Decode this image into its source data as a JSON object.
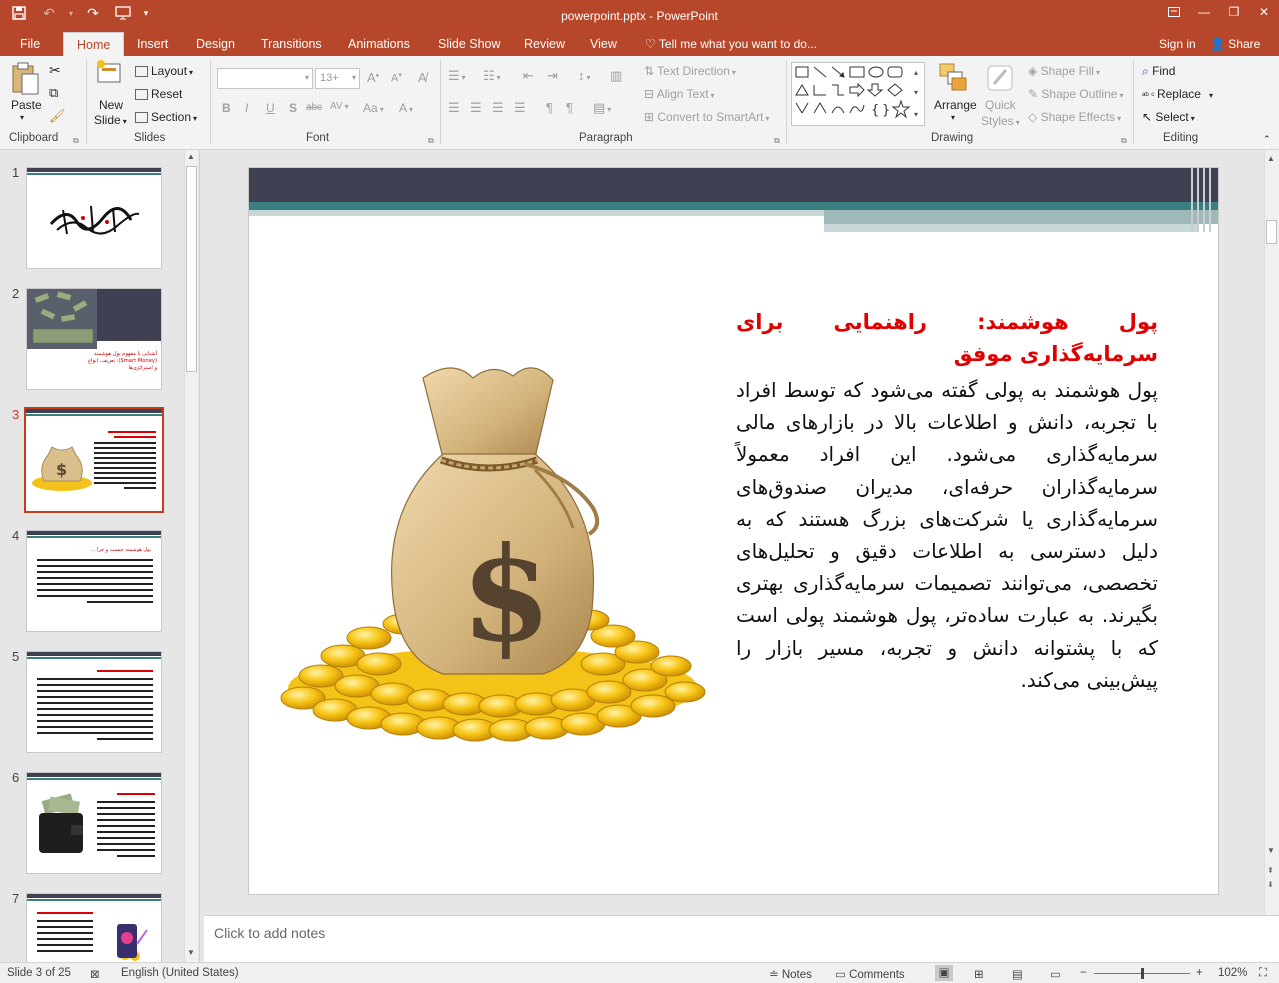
{
  "window": {
    "title": "powerpoint.pptx - PowerPoint"
  },
  "tabs": [
    {
      "label": "File"
    },
    {
      "label": "Home"
    },
    {
      "label": "Insert"
    },
    {
      "label": "Design"
    },
    {
      "label": "Transitions"
    },
    {
      "label": "Animations"
    },
    {
      "label": "Slide Show"
    },
    {
      "label": "Review"
    },
    {
      "label": "View"
    }
  ],
  "tell_me": "Tell me what you want to do...",
  "account": {
    "signin": "Sign in",
    "share": "Share"
  },
  "ribbon": {
    "clipboard": {
      "label": "Clipboard",
      "paste": "Paste"
    },
    "slides": {
      "label": "Slides",
      "new_slide_1": "New",
      "new_slide_2": "Slide",
      "layout": "Layout",
      "reset": "Reset",
      "section": "Section"
    },
    "font": {
      "label": "Font",
      "size": "13+",
      "bold": "B",
      "italic": "I",
      "underline": "U",
      "shadow": "S",
      "strike": "abc",
      "spacing": "AV",
      "case": "Aa"
    },
    "paragraph": {
      "label": "Paragraph",
      "text_direction": "Text Direction",
      "align_text": "Align Text",
      "smartart": "Convert to SmartArt"
    },
    "drawing": {
      "label": "Drawing",
      "arrange": "Arrange",
      "quick_styles_1": "Quick",
      "quick_styles_2": "Styles",
      "shape_fill": "Shape Fill",
      "shape_outline": "Shape Outline",
      "shape_effects": "Shape Effects"
    },
    "editing": {
      "label": "Editing",
      "find": "Find",
      "replace": "Replace",
      "select": "Select"
    }
  },
  "thumbnails": [
    {
      "num": "1"
    },
    {
      "num": "2",
      "text": "آشنایی با مفهوم پول هوشمند (Smart Money): تعریف، انواع و استراتژی‌ها"
    },
    {
      "num": "3"
    },
    {
      "num": "4",
      "text": "پول هوشمند چیست و چرا ..."
    },
    {
      "num": "5"
    },
    {
      "num": "6"
    },
    {
      "num": "7"
    }
  ],
  "slide": {
    "title": "پول هوشمند: راهنمایی برای سرمایه‌گذاری موفق",
    "body": "پول هوشمند به پولی گفته می‌شود که توسط افراد با تجربه، دانش و اطلاعات بالا در بازارهای مالی سرمایه‌گذاری می‌شود. این افراد معمولاً سرمایه‌گذاران حرفه‌ای، مدیران صندوق‌های سرمایه‌گذاری یا شرکت‌های بزرگ هستند که به دلیل دسترسی به اطلاعات دقیق و تحلیل‌های تخصصی، می‌توانند تصمیمات سرمایه‌گذاری بهتری بگیرند. به عبارت ساده‌تر، پول هوشمند پولی است که با پشتوانه دانش و تجربه، مسیر بازار را پیش‌بینی می‌کند.",
    "dollar": "$"
  },
  "notes": {
    "placeholder": "Click to add notes"
  },
  "status": {
    "slide_of": "Slide 3 of 25",
    "language": "English (United States)",
    "notes": "Notes",
    "comments": "Comments",
    "zoom": "102%"
  },
  "colors": {
    "accent": "#b7472a",
    "slide_title": "#e00000",
    "header_dark": "#3f4153",
    "header_teal": "#3b7e80"
  }
}
